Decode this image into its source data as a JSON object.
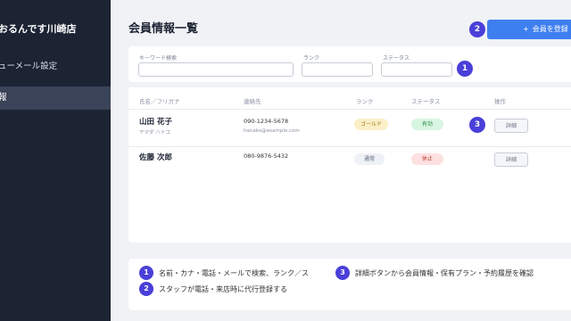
{
  "sidebar": {
    "title": "おるんです川崎店",
    "items": [
      {
        "label": "ューメール設定",
        "active": false
      },
      {
        "label": "報",
        "active": true
      }
    ]
  },
  "header": {
    "title": "会員情報一覧",
    "add_button": "会員を登録",
    "add_icon": "+"
  },
  "filters": {
    "keyword_label": "キーワード検索",
    "keyword_value": "",
    "rank_label": "ランク",
    "rank_value": "",
    "status_label": "ステータス",
    "status_value": ""
  },
  "table": {
    "columns": [
      "氏名／フリガナ",
      "連絡先",
      "ランク",
      "ステータス",
      "操作"
    ],
    "rows": [
      {
        "name": "山田 花子",
        "kana": "ヤマダ ハナコ",
        "phone": "090-1234-5678",
        "email": "hanako@example.com",
        "rank": "ゴールド",
        "status": "有効",
        "action": "詳細"
      },
      {
        "name": "佐藤 次郎",
        "kana": "",
        "phone": "080-9876-5432",
        "email": "",
        "rank": "通常",
        "status": "休止",
        "action": "詳細"
      }
    ]
  },
  "callouts": {
    "badge1": "1",
    "badge2": "2",
    "badge3": "3"
  },
  "notes": [
    {
      "num": "1",
      "text": "名前・カナ・電話・メールで検索、ランク／ス"
    },
    {
      "num": "3",
      "text": "詳細ボタンから会員情報・保有プラン・予約履歴を確認"
    },
    {
      "num": "2",
      "text": "スタッフが電話・来店時に代行登録する"
    }
  ],
  "colors": {
    "sidebar_bg": "#1c2333",
    "accent": "#3e7ff0",
    "badge": "#4a3fd8",
    "gold_bg": "#fbefc8",
    "active_bg": "#d8f5e2",
    "suspended_bg": "#fde0e0"
  }
}
